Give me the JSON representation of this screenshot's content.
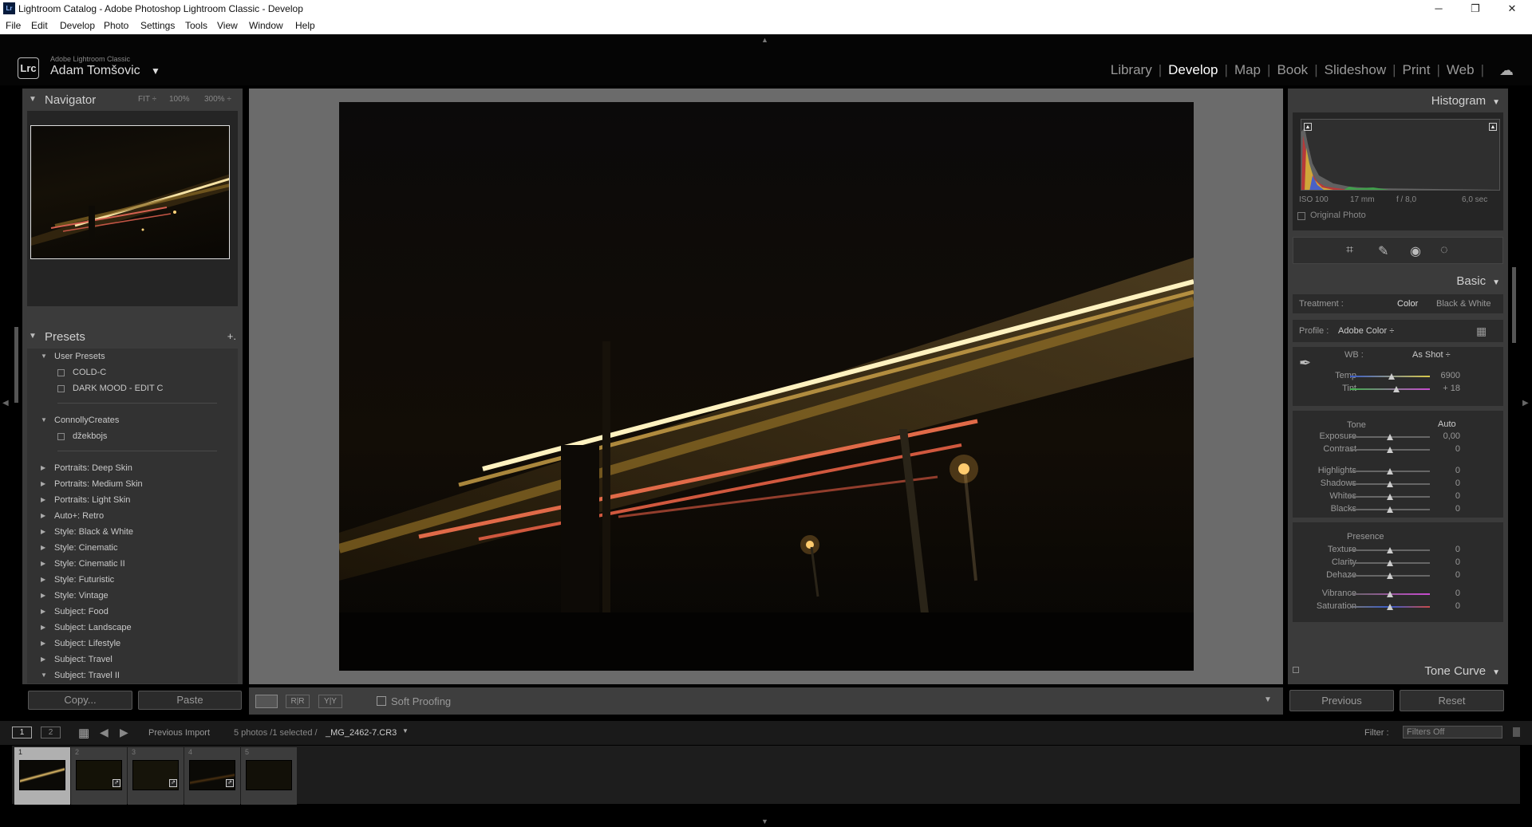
{
  "window": {
    "title": "Lightroom Catalog - Adobe Photoshop Lightroom Classic - Develop",
    "minimize": "─",
    "maximize": "❐",
    "close": "✕"
  },
  "menu": [
    "File",
    "Edit",
    "Develop",
    "Photo",
    "Settings",
    "Tools",
    "View",
    "Window",
    "Help"
  ],
  "identity": {
    "logo": "Lrc",
    "product": "Adobe Lightroom Classic",
    "user": "Adam Tomšovic",
    "caret": "▼"
  },
  "modules": [
    "Library",
    "Develop",
    "Map",
    "Book",
    "Slideshow",
    "Print",
    "Web"
  ],
  "module_active": "Develop",
  "navigator": {
    "title": "Navigator",
    "fit": "FIT ÷",
    "z100": "100%",
    "z300": "300% ÷"
  },
  "presets": {
    "title": "Presets",
    "add": "+.",
    "groups": [
      {
        "name": "User Presets",
        "open": true,
        "items": [
          "COLD-C",
          "DARK MOOD - EDIT C"
        ]
      },
      {
        "name": "ConnollyCreates",
        "open": true,
        "items": [
          "džekbojs"
        ]
      }
    ],
    "collapsed": [
      "Portraits: Deep Skin",
      "Portraits: Medium Skin",
      "Portraits: Light Skin",
      "Auto+: Retro",
      "Style: Black & White",
      "Style: Cinematic",
      "Style: Cinematic II",
      "Style: Futuristic",
      "Style: Vintage",
      "Subject: Food",
      "Subject: Landscape",
      "Subject: Lifestyle",
      "Subject: Travel",
      "Subject: Travel II"
    ]
  },
  "left_buttons": {
    "copy": "Copy...",
    "paste": "Paste"
  },
  "toolbar": {
    "soft_proofing": "Soft Proofing",
    "view_ba": "R|R",
    "view_yy": "Y|Y"
  },
  "histogram": {
    "title": "Histogram",
    "iso": "ISO 100",
    "focal": "17 mm",
    "aperture": "f / 8,0",
    "shutter": "6,0 sec",
    "original_photo": "Original Photo"
  },
  "basic": {
    "title": "Basic",
    "treatment_label": "Treatment :",
    "treatment_color": "Color",
    "treatment_bw": "Black & White",
    "profile_label": "Profile :",
    "profile_value": "Adobe Color ÷",
    "wb_label": "WB :",
    "wb_value": "As Shot ÷",
    "tone_label": "Tone",
    "auto": "Auto",
    "presence_label": "Presence",
    "sliders": [
      {
        "name": "Temp",
        "value": "6900"
      },
      {
        "name": "Tint",
        "value": "+ 18"
      },
      {
        "name": "Exposure",
        "value": "0,00"
      },
      {
        "name": "Contrast",
        "value": "0"
      },
      {
        "name": "Highlights",
        "value": "0"
      },
      {
        "name": "Shadows",
        "value": "0"
      },
      {
        "name": "Whites",
        "value": "0"
      },
      {
        "name": "Blacks",
        "value": "0"
      },
      {
        "name": "Texture",
        "value": "0"
      },
      {
        "name": "Clarity",
        "value": "0"
      },
      {
        "name": "Dehaze",
        "value": "0"
      },
      {
        "name": "Vibrance",
        "value": "0"
      },
      {
        "name": "Saturation",
        "value": "0"
      }
    ]
  },
  "tone_curve": {
    "title": "Tone Curve"
  },
  "right_buttons": {
    "previous": "Previous",
    "reset": "Reset"
  },
  "filmbar": {
    "screen1": "1",
    "screen2": "2",
    "source": "Previous Import",
    "count": "5 photos /1 selected /",
    "filename": "_MG_2462-7.CR3",
    "filter_label": "Filter :",
    "filter_value": "Filters Off"
  },
  "filmstrip": [
    {
      "n": "1"
    },
    {
      "n": "2"
    },
    {
      "n": "3"
    },
    {
      "n": "4"
    },
    {
      "n": "5"
    }
  ]
}
